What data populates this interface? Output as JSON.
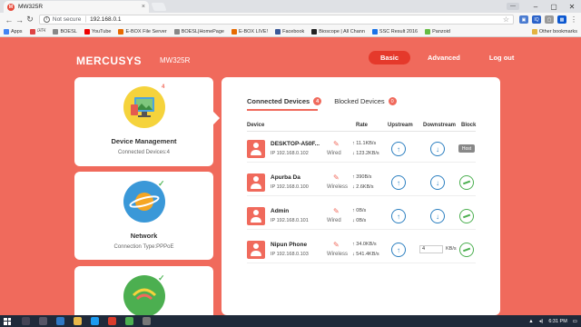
{
  "browser": {
    "tab_title": "MW325R",
    "tab_favicon": "M",
    "url_security": "Not secure",
    "url": "192.168.0.1",
    "user": "—",
    "bookmarks": [
      {
        "label": "Apps",
        "color": "#4285f4"
      },
      {
        "label": "মোম",
        "color": "#d44"
      },
      {
        "label": "BOESL",
        "color": "#888"
      },
      {
        "label": "YouTube",
        "color": "#e00"
      },
      {
        "label": "E-BOX File Server",
        "color": "#e66a00"
      },
      {
        "label": "BOESL|HomePage",
        "color": "#888"
      },
      {
        "label": "E-BOX LIVE!",
        "color": "#e66a00"
      },
      {
        "label": "Facebook",
        "color": "#3b5998"
      },
      {
        "label": "Bioscope | All Chann",
        "color": "#222"
      },
      {
        "label": "SSC Result 2016",
        "color": "#1a73e8"
      },
      {
        "label": "Panzoid",
        "color": "#6b4"
      }
    ],
    "other_bookmarks": "Other bookmarks"
  },
  "router": {
    "brand": "MERCUSYS",
    "model": "MW325R",
    "nav": [
      "Basic",
      "Advanced",
      "Log out"
    ]
  },
  "sidebar": {
    "device_management": {
      "title": "Device Management",
      "sub": "Connected Devices:4",
      "badge": "4"
    },
    "network": {
      "title": "Network",
      "sub": "Connection Type:PPPoE"
    }
  },
  "panel": {
    "tabs": [
      {
        "label": "Connected Devices",
        "count": "4"
      },
      {
        "label": "Blocked Devices",
        "count": "0"
      }
    ],
    "columns": [
      "Device",
      "Rate",
      "Upstream",
      "Downstream",
      "Block"
    ],
    "devices": [
      {
        "name": "DESKTOP-A50F...",
        "ip": "IP 192.168.0.102",
        "conn": "Wired",
        "up": "↑ 11.1KB/s",
        "down": "↓ 123.2KB/s",
        "host": "Host"
      },
      {
        "name": "Apurba Da",
        "ip": "IP 192.168.0.100",
        "conn": "Wireless",
        "up": "↑ 390B/s",
        "down": "↓ 2.6KB/s"
      },
      {
        "name": "Admin",
        "ip": "IP 192.168.0.101",
        "conn": "Wired",
        "up": "↑ 0B/s",
        "down": "↓ 0B/s"
      },
      {
        "name": "Nipun Phone",
        "ip": "IP 192.168.0.103",
        "conn": "Wireless",
        "up": "↑ 34.0KB/s",
        "down": "↓ 541.4KB/s",
        "limit_value": "4",
        "limit_unit": "KB/s"
      }
    ]
  },
  "taskbar": {
    "time": "6:31 PM"
  }
}
